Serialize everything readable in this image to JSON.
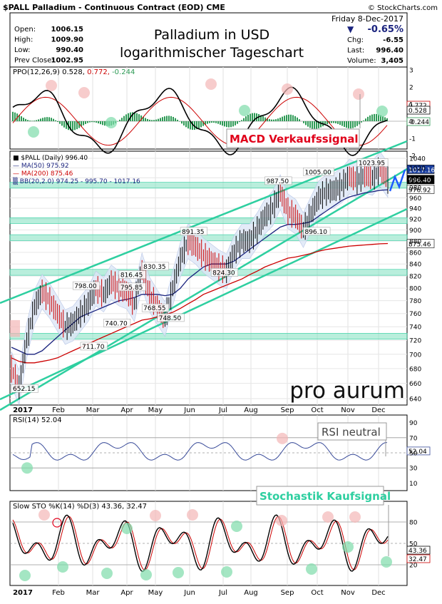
{
  "header": {
    "ticker_title": "$PALL Palladium - Continuous Contract (EOD) CME",
    "watermark": "© StockCharts.com",
    "date": "Friday  8-Dec-2017",
    "stats_left": [
      {
        "label": "Open:",
        "value": "1006.15"
      },
      {
        "label": "High:",
        "value": "1009.90"
      },
      {
        "label": "Low:",
        "value": "990.40"
      },
      {
        "label": "Prev Close:",
        "value": "1002.95"
      }
    ],
    "stats_right": [
      {
        "label": "Chg:",
        "value": "-6.55"
      },
      {
        "label": "Last:",
        "value": "996.40"
      },
      {
        "label": "Volume:",
        "value": "3,405"
      }
    ],
    "pct_change": "-0.65%",
    "chart_title_line1": "Palladium in USD",
    "chart_title_line2": "logarithmischer Tageschart"
  },
  "colors": {
    "accent_red": "#e0001a",
    "channel_green": "#2ecfa0",
    "zone_green": "#7fe0c0",
    "highlight_pink": "#f4b6b6",
    "highlight_green": "#7ddba9",
    "price_up": "#000000",
    "price_down": "#cc0000",
    "ma50": "#1a237e",
    "ma200": "#cc0000",
    "bb_fill": "#dde6f6",
    "annotation_blue": "#1e5cff"
  },
  "panels": {
    "ppo": {
      "legend": "PPO(12,26,9) 0.528, 0.772, -0.244",
      "legend_parts": [
        "PPO(12,26,9) 0.528,",
        " 0.772,",
        " -0.244"
      ],
      "y_ticks": [
        "3",
        "2",
        "1",
        "0",
        "-1",
        "-2"
      ],
      "value_boxes": [
        "0.772",
        "0.528",
        "-0.244"
      ],
      "annotation": "MACD Verkaufssignal"
    },
    "price": {
      "legend": "$PALL (Daily) 996.40",
      "legend_items": [
        "■ $PALL (Daily) 996.40",
        "— MA(50) 975.92",
        "— MA(200) 875.46",
        "▒ BB(20,2.0) 974.25 - 995.70 - 1017.16"
      ],
      "y_ticks": [
        "1040",
        "1020",
        "1000",
        "980",
        "960",
        "940",
        "920",
        "900",
        "880",
        "860",
        "840",
        "820",
        "800",
        "780",
        "760",
        "740",
        "720",
        "700",
        "680",
        "660",
        "640"
      ],
      "value_boxes": [
        "1017.16",
        "996.40",
        "976.92",
        "875.46"
      ],
      "point_labels": [
        "652.15",
        "798.00",
        "795.85",
        "711.70",
        "740.70",
        "816.45",
        "830.35",
        "768.55",
        "748.50",
        "891.35",
        "824.30",
        "987.50",
        "1005.00",
        "896.10",
        "1023.95"
      ],
      "brand": "pro aurum"
    },
    "rsi": {
      "legend": "RSI(14) 52.04",
      "y_ticks": [
        "90",
        "70",
        "50",
        "30",
        "10"
      ],
      "value_box": "52.04",
      "annotation": "RSI neutral"
    },
    "sto": {
      "legend": "Slow STO %K(14) %D(3) 43.36, 32.47",
      "y_ticks": [
        "80",
        "50",
        "20"
      ],
      "value_boxes": [
        "43.36",
        "32.47"
      ],
      "annotation": "Stochastik Kaufsignal"
    }
  },
  "x_axis": {
    "year_label": "2017",
    "months": [
      "Feb",
      "Mar",
      "Apr",
      "May",
      "Jun",
      "Jul",
      "Aug",
      "Sep",
      "Oct",
      "Nov",
      "Dec"
    ]
  },
  "chart_data": {
    "type": "line",
    "title": "Palladium in USD logarithmischer Tageschart",
    "scale": "log",
    "ylim": [
      640,
      1050
    ],
    "x": [
      "2017-01-03",
      "2017-01-09",
      "2017-01-17",
      "2017-01-24",
      "2017-01-31",
      "2017-02-08",
      "2017-02-15",
      "2017-02-22",
      "2017-03-01",
      "2017-03-08",
      "2017-03-15",
      "2017-03-22",
      "2017-03-29",
      "2017-04-05",
      "2017-04-12",
      "2017-04-19",
      "2017-04-26",
      "2017-05-03",
      "2017-05-10",
      "2017-05-17",
      "2017-05-24",
      "2017-05-31",
      "2017-06-07",
      "2017-06-14",
      "2017-06-21",
      "2017-06-28",
      "2017-07-05",
      "2017-07-12",
      "2017-07-19",
      "2017-07-26",
      "2017-08-02",
      "2017-08-09",
      "2017-08-16",
      "2017-08-23",
      "2017-08-30",
      "2017-09-06",
      "2017-09-13",
      "2017-09-20",
      "2017-09-27",
      "2017-10-04",
      "2017-10-11",
      "2017-10-18",
      "2017-10-25",
      "2017-11-01",
      "2017-11-08",
      "2017-11-15",
      "2017-11-22",
      "2017-11-29",
      "2017-12-06",
      "2017-12-08"
    ],
    "series": [
      {
        "name": "$PALL (Daily)",
        "values": [
          680,
          655,
          720,
          770,
          795,
          780,
          760,
          740,
          745,
          760,
          775,
          800,
          790,
          810,
          800,
          795,
          775,
          830,
          790,
          770,
          752,
          800,
          848,
          880,
          870,
          855,
          845,
          835,
          828,
          860,
          880,
          880,
          900,
          925,
          940,
          972,
          935,
          925,
          900,
          930,
          960,
          972,
          975,
          985,
          1003,
          995,
          1005,
          1000,
          1018,
          996
        ]
      },
      {
        "name": "MA(50)",
        "values": [
          710,
          705,
          700,
          700,
          705,
          715,
          725,
          735,
          745,
          755,
          760,
          765,
          770,
          775,
          780,
          782,
          785,
          790,
          790,
          790,
          788,
          790,
          800,
          815,
          825,
          835,
          840,
          840,
          840,
          845,
          855,
          865,
          875,
          885,
          895,
          905,
          910,
          910,
          912,
          915,
          925,
          935,
          945,
          955,
          962,
          966,
          970,
          972,
          975,
          975.92
        ]
      },
      {
        "name": "MA(200)",
        "values": [
          695,
          690,
          688,
          688,
          690,
          692,
          695,
          700,
          705,
          710,
          715,
          720,
          725,
          730,
          735,
          740,
          745,
          750,
          752,
          755,
          758,
          762,
          768,
          775,
          782,
          790,
          795,
          800,
          805,
          810,
          815,
          822,
          828,
          835,
          840,
          845,
          850,
          852,
          855,
          858,
          862,
          865,
          867,
          869,
          871,
          872,
          873,
          874,
          875,
          875.46
        ]
      }
    ],
    "support_lines": [
      "985",
      "917",
      "886",
      "826",
      "726"
    ]
  }
}
